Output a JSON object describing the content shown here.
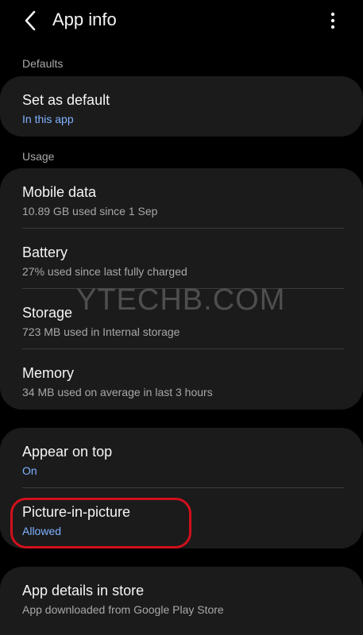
{
  "header": {
    "title": "App info",
    "back_icon": "chevron-left-icon",
    "more_icon": "more-vertical-icon"
  },
  "sections": {
    "defaults": {
      "header": "Defaults",
      "items": [
        {
          "label": "Set as default",
          "sub": "In this app"
        }
      ]
    },
    "usage": {
      "header": "Usage",
      "items": [
        {
          "label": "Mobile data",
          "sub": "10.89 GB used since 1 Sep"
        },
        {
          "label": "Battery",
          "sub": "27% used since last fully charged"
        },
        {
          "label": "Storage",
          "sub": "723 MB used in Internal storage"
        },
        {
          "label": "Memory",
          "sub": "34 MB used on average in last 3 hours"
        }
      ]
    },
    "permissions": {
      "items": [
        {
          "label": "Appear on top",
          "sub": "On"
        },
        {
          "label": "Picture-in-picture",
          "sub": "Allowed"
        }
      ]
    },
    "store": {
      "items": [
        {
          "label": "App details in store",
          "sub": "App downloaded from Google Play Store"
        }
      ]
    }
  },
  "watermark": "YTECHB.COM",
  "colors": {
    "background": "#000000",
    "card": "#1b1b1b",
    "accent": "#7fb2ff",
    "highlight": "#d0101c"
  }
}
